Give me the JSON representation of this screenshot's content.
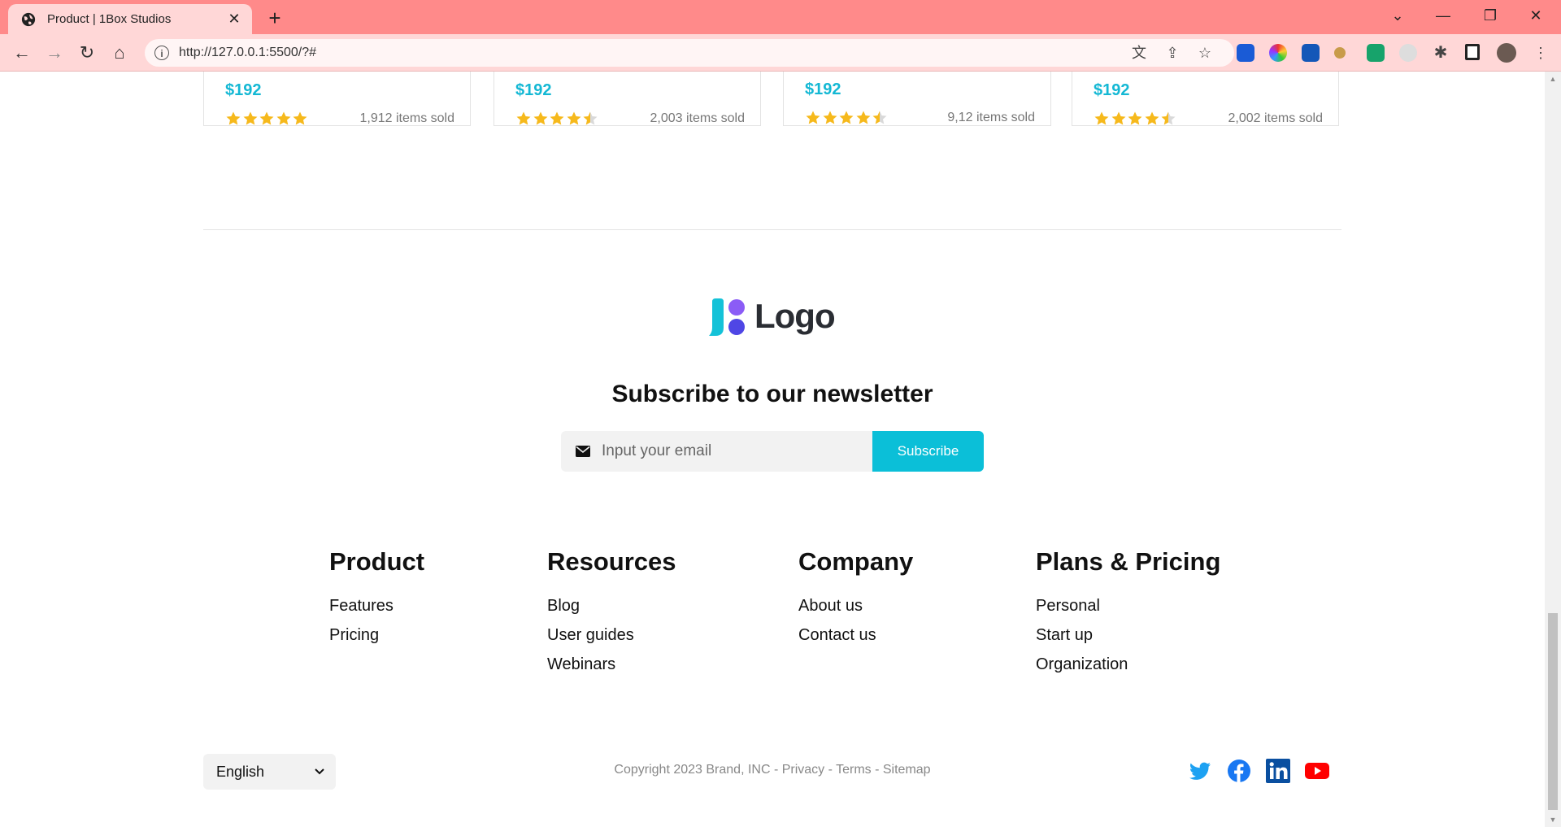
{
  "browser": {
    "tab_title": "Product | 1Box Studios",
    "url": "http://127.0.0.1:5500/?#"
  },
  "products": [
    {
      "price": "$192",
      "rating": 5,
      "sold": "1,912 items sold"
    },
    {
      "price": "$192",
      "rating": 4.5,
      "sold": "2,003 items sold"
    },
    {
      "price": "$192",
      "rating": 4.5,
      "sold": "9,12 items sold"
    },
    {
      "price": "$192",
      "rating": 4.5,
      "sold": "2,002 items sold"
    }
  ],
  "footer": {
    "logo_text": "Logo",
    "newsletter": {
      "title": "Subscribe to our newsletter",
      "placeholder": "Input your email",
      "button": "Subscribe"
    },
    "columns": {
      "product": {
        "title": "Product",
        "links": [
          "Features",
          "Pricing"
        ]
      },
      "resources": {
        "title": "Resources",
        "links": [
          "Blog",
          "User guides",
          "Webinars"
        ]
      },
      "company": {
        "title": "Company",
        "links": [
          "About us",
          "Contact us"
        ]
      },
      "plans": {
        "title": "Plans & Pricing",
        "links": [
          "Personal",
          "Start up",
          "Organization"
        ]
      }
    },
    "language": "English",
    "copyright": "Copyright 2023 Brand, INC - Privacy - Terms - Sitemap",
    "social": [
      "twitter-icon",
      "facebook-icon",
      "linkedin-icon",
      "youtube-icon"
    ]
  },
  "colors": {
    "accent": "#0bbfd8",
    "price": "#14b8d4",
    "star": "#f6b91c",
    "tabbar": "#ff8a8a",
    "toolbar": "#ffd7d7"
  }
}
